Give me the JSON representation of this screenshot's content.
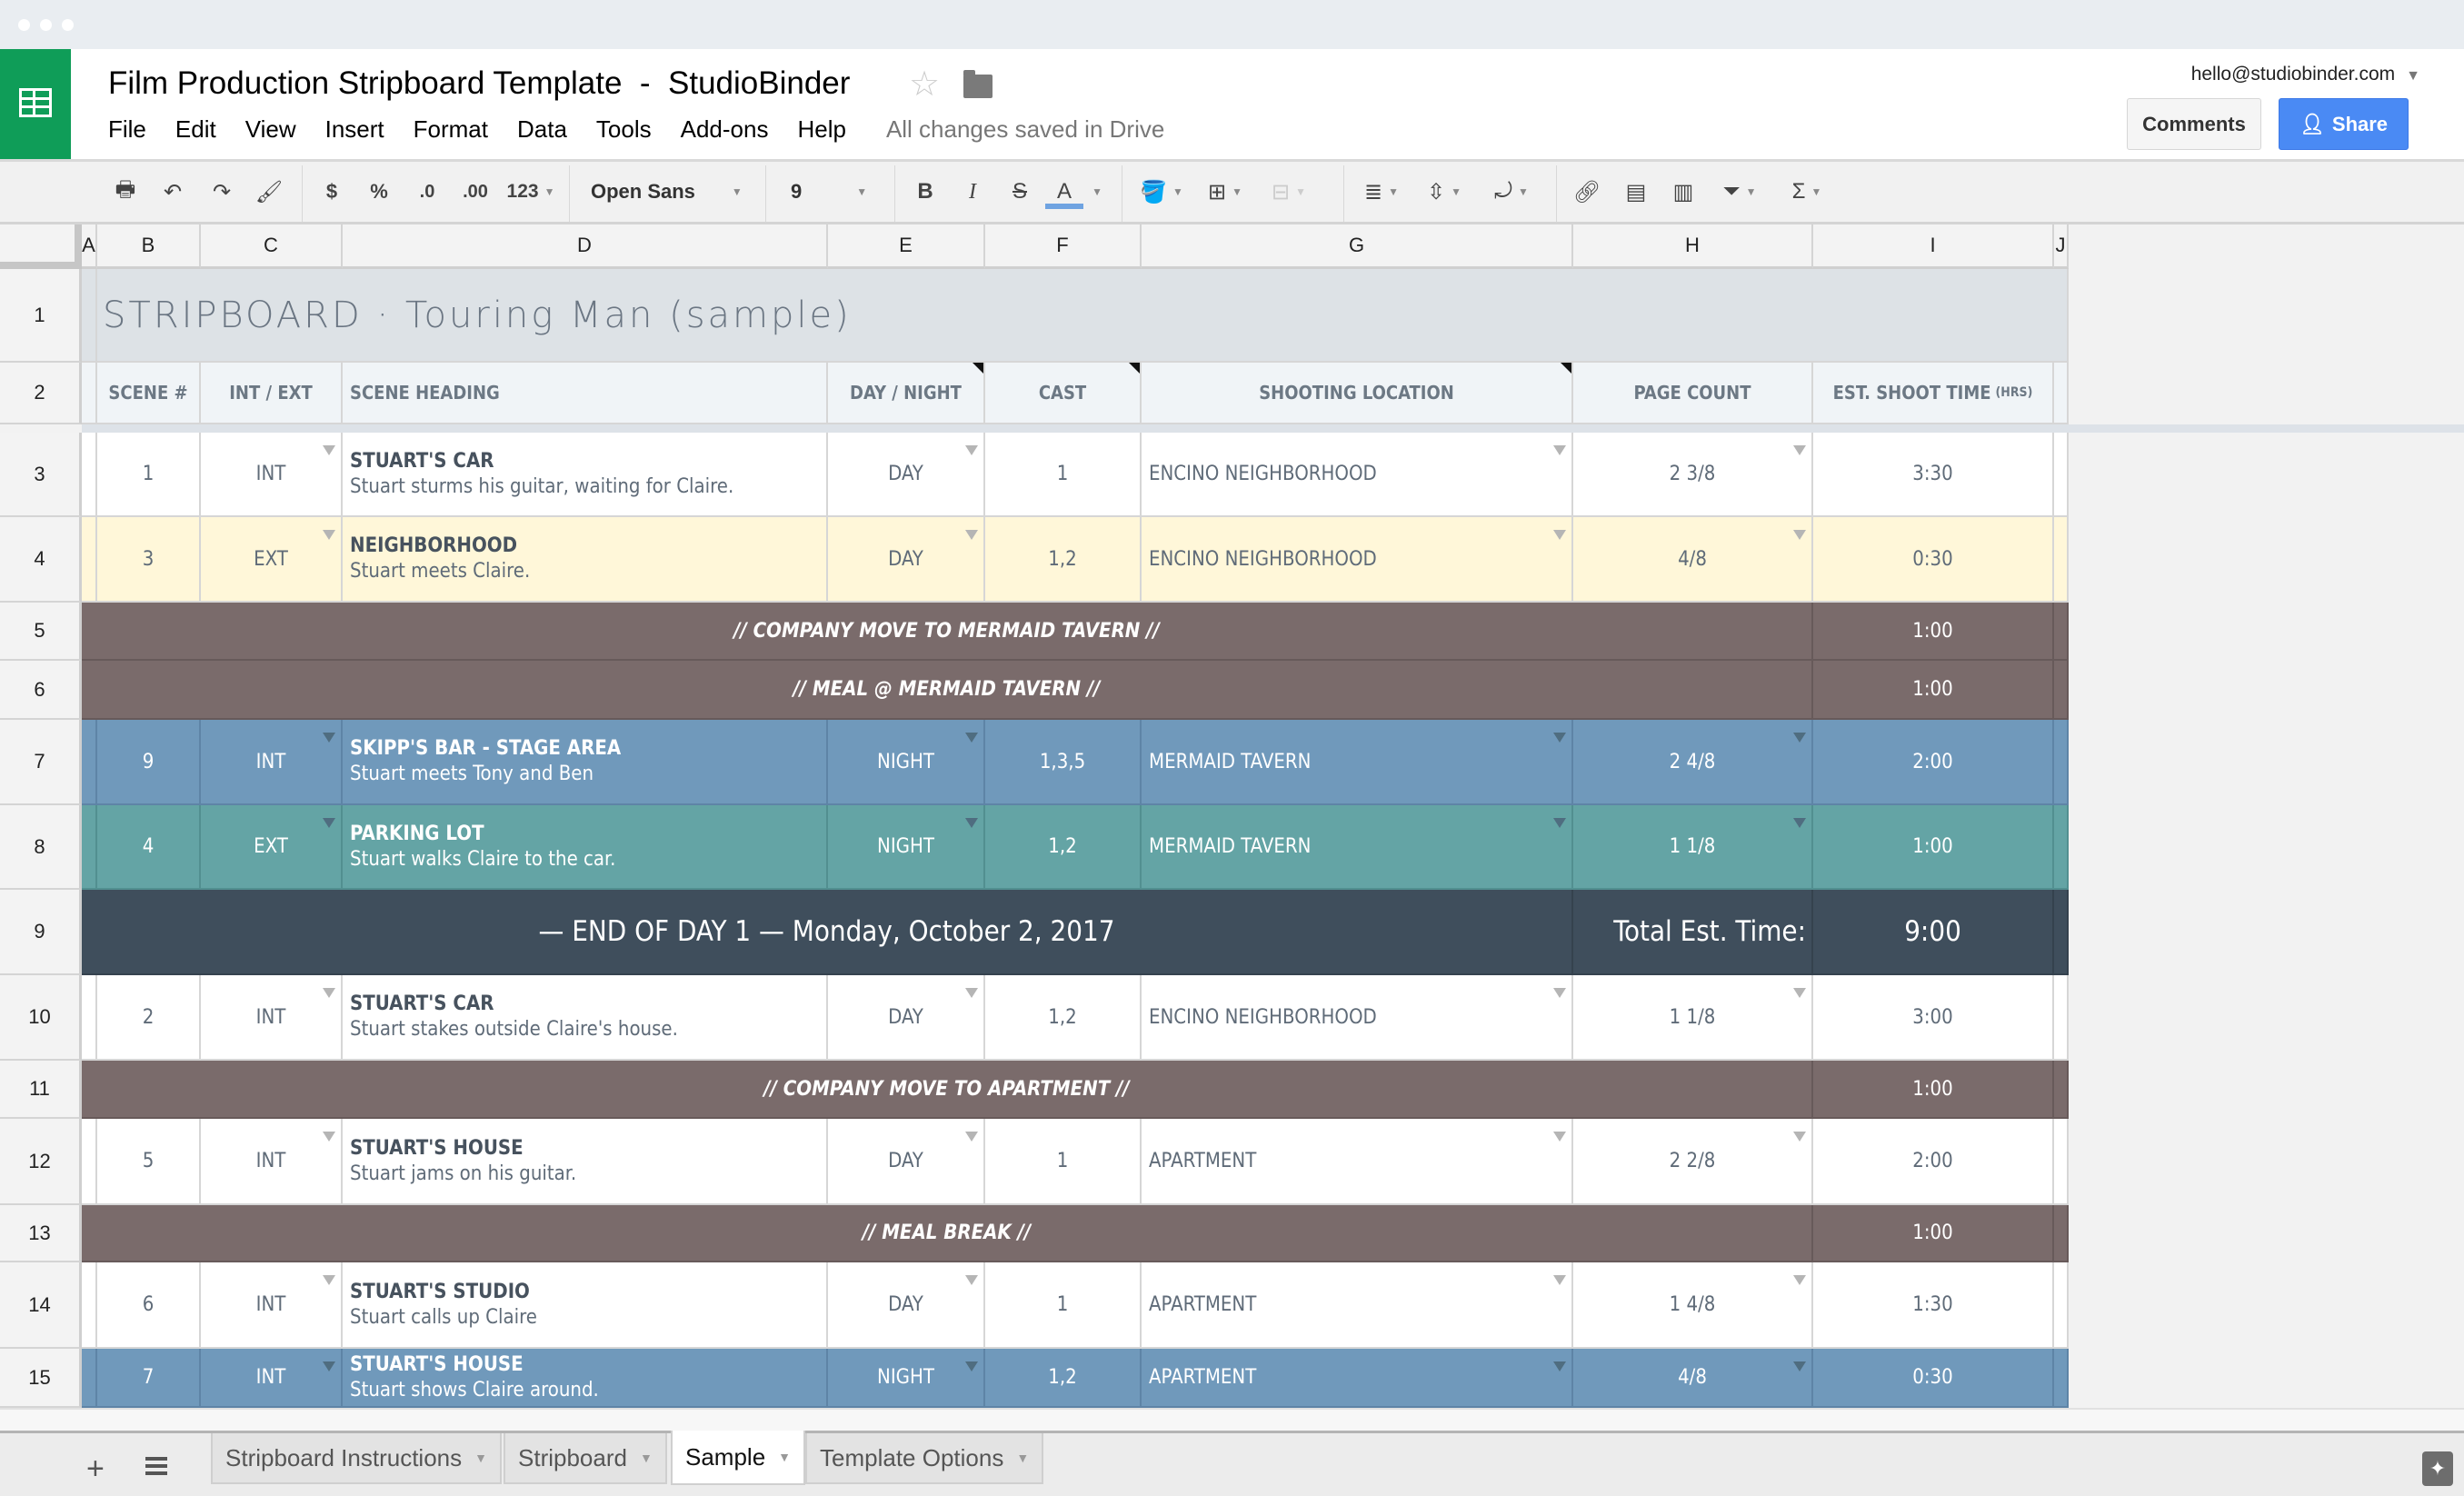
{
  "window": {
    "controls": [
      "close",
      "minimize",
      "maximize"
    ]
  },
  "app": {
    "title": "Film Production Stripboard Template  -  StudioBinder",
    "logo_icon": "sheets-icon",
    "star_icon": "star-outline-icon",
    "folder_icon": "folder-icon",
    "menu": [
      "File",
      "Edit",
      "View",
      "Insert",
      "Format",
      "Data",
      "Tools",
      "Add-ons",
      "Help"
    ],
    "save_status": "All changes saved in Drive",
    "account": "hello@studiobinder.com",
    "comments_label": "Comments",
    "share_label": "Share"
  },
  "toolbar": {
    "currency": "$",
    "percent": "%",
    "dec_decrease": ".0",
    "dec_increase": ".00",
    "more_formats": "123",
    "font": "Open Sans",
    "font_size": "9",
    "bold": "B",
    "italic": "I",
    "strike": "S",
    "text_color": "A",
    "sum": "Σ",
    "text_color_accent": "#6fa3e1"
  },
  "columns": [
    "A",
    "B",
    "C",
    "D",
    "E",
    "F",
    "G",
    "H",
    "I",
    "J"
  ],
  "sheet": {
    "title": "STRIPBOARD · Touring Man (sample)",
    "headers": {
      "scene": "SCENE #",
      "int_ext": "INT / EXT",
      "heading": "SCENE HEADING",
      "day_night": "DAY / NIGHT",
      "cast": "CAST",
      "location": "SHOOTING LOCATION",
      "page_count": "PAGE COUNT",
      "shoot_time": "EST. SHOOT TIME",
      "shoot_time_unit": "(HRS)"
    },
    "rows": [
      {
        "row": "1"
      },
      {
        "row": "2"
      },
      {
        "row": "3",
        "type": "scene",
        "color": "white",
        "scene": "1",
        "int_ext": "INT",
        "heading": "STUART'S CAR",
        "desc": "Stuart sturms his guitar, waiting for Claire.",
        "day_night": "DAY",
        "cast": "1",
        "location": "ENCINO NEIGHBORHOOD",
        "pages": "2 3/8",
        "time": "3:30"
      },
      {
        "row": "4",
        "type": "scene",
        "color": "yellow",
        "scene": "3",
        "int_ext": "EXT",
        "heading": "NEIGHBORHOOD",
        "desc": "Stuart meets Claire.",
        "day_night": "DAY",
        "cast": "1,2",
        "location": "ENCINO NEIGHBORHOOD",
        "pages": "4/8",
        "time": "0:30"
      },
      {
        "row": "5",
        "type": "break",
        "text": "// COMPANY MOVE TO MERMAID TAVERN //",
        "time": "1:00"
      },
      {
        "row": "6",
        "type": "break",
        "text": "// MEAL @ MERMAID TAVERN //",
        "time": "1:00"
      },
      {
        "row": "7",
        "type": "scene",
        "color": "blue",
        "scene": "9",
        "int_ext": "INT",
        "heading": "SKIPP'S BAR - STAGE AREA",
        "desc": "Stuart meets Tony and Ben",
        "day_night": "NIGHT",
        "cast": "1,3,5",
        "location": "MERMAID TAVERN",
        "pages": "2 4/8",
        "time": "2:00"
      },
      {
        "row": "8",
        "type": "scene",
        "color": "teal",
        "scene": "4",
        "int_ext": "EXT",
        "heading": "PARKING LOT",
        "desc": "Stuart walks Claire to the car.",
        "day_night": "NIGHT",
        "cast": "1,2",
        "location": "MERMAID TAVERN",
        "pages": "1 1/8",
        "time": "1:00"
      },
      {
        "row": "9",
        "type": "day_end",
        "text": "— END OF DAY 1 —  Monday, October 2, 2017",
        "total_label": "Total Est. Time:",
        "time": "9:00"
      },
      {
        "row": "10",
        "type": "scene",
        "color": "white",
        "scene": "2",
        "int_ext": "INT",
        "heading": "STUART'S CAR",
        "desc": "Stuart stakes outside Claire's house.",
        "day_night": "DAY",
        "cast": "1,2",
        "location": "ENCINO NEIGHBORHOOD",
        "pages": "1 1/8",
        "time": "3:00"
      },
      {
        "row": "11",
        "type": "break",
        "text": "// COMPANY MOVE TO APARTMENT //",
        "time": "1:00"
      },
      {
        "row": "12",
        "type": "scene",
        "color": "white",
        "scene": "5",
        "int_ext": "INT",
        "heading": "STUART'S HOUSE",
        "desc": "Stuart jams on his guitar.",
        "day_night": "DAY",
        "cast": "1",
        "location": "APARTMENT",
        "pages": "2 2/8",
        "time": "2:00"
      },
      {
        "row": "13",
        "type": "break",
        "text": "// MEAL BREAK //",
        "time": "1:00"
      },
      {
        "row": "14",
        "type": "scene",
        "color": "white",
        "scene": "6",
        "int_ext": "INT",
        "heading": "STUART'S STUDIO",
        "desc": "Stuart calls up Claire",
        "day_night": "DAY",
        "cast": "1",
        "location": "APARTMENT",
        "pages": "1 4/8",
        "time": "1:30"
      },
      {
        "row": "15",
        "type": "scene",
        "color": "blue",
        "scene": "7",
        "int_ext": "INT",
        "heading": "STUART'S HOUSE",
        "desc": "Stuart shows Claire around.",
        "day_night": "NIGHT",
        "cast": "1,2",
        "location": "APARTMENT",
        "pages": "4/8",
        "time": "0:30"
      }
    ],
    "colors": {
      "white": "#ffffff",
      "yellow": "#fff7d9",
      "break": "#7a6b6b",
      "blue": "#7099bb",
      "teal": "#64a4a5",
      "day_end": "#3f4e5c"
    }
  },
  "tabs": {
    "add_icon": "plus-icon",
    "list_icon": "sheet-list-icon",
    "items": [
      {
        "label": "Stripboard Instructions",
        "active": false
      },
      {
        "label": "Stripboard",
        "active": false
      },
      {
        "label": "Sample",
        "active": true
      },
      {
        "label": "Template Options",
        "active": false
      }
    ],
    "explore_icon": "explore-icon"
  }
}
